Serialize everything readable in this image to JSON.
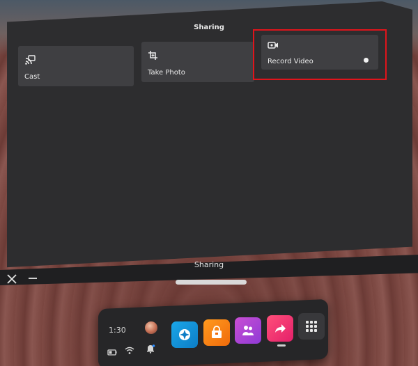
{
  "window": {
    "header_title": "Sharing",
    "title_bar_label": "Sharing"
  },
  "tiles": [
    {
      "label": "Cast",
      "icon": "cast-icon"
    },
    {
      "label": "Take Photo",
      "icon": "camera-frame-icon"
    },
    {
      "label": "Record Video",
      "icon": "video-camera-icon",
      "highlighted": true,
      "highlight_color": "#e0141b"
    }
  ],
  "dock": {
    "time": "1:30",
    "apps": [
      {
        "name": "explore-app",
        "icon": "compass-icon",
        "color": "#1aa6e8"
      },
      {
        "name": "store-app",
        "icon": "shopping-bag-icon",
        "color": "#ff9a1f"
      },
      {
        "name": "people-app",
        "icon": "people-icon",
        "color": "#c94fd3"
      },
      {
        "name": "sharing-app",
        "icon": "share-arrow-icon",
        "color": "#ff4f7a",
        "active": true
      },
      {
        "name": "app-library",
        "icon": "grid-icon",
        "color": "#38383b"
      }
    ],
    "status_icons": [
      "battery-icon",
      "wifi-icon",
      "notification-bell-icon"
    ]
  }
}
